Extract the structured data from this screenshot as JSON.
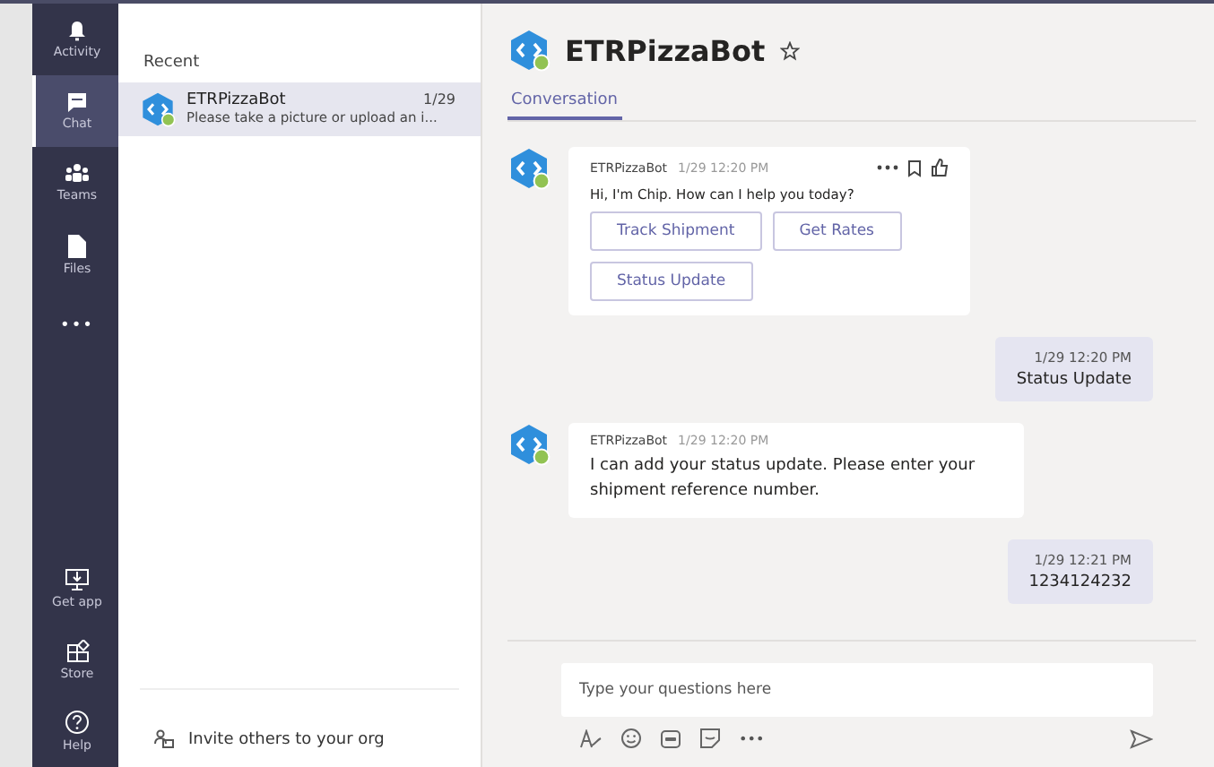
{
  "rail": {
    "top": [
      {
        "kind": "bell",
        "label": "Activity",
        "selected": false
      },
      {
        "kind": "chat",
        "label": "Chat",
        "selected": true
      },
      {
        "kind": "teams",
        "label": "Teams",
        "selected": false
      },
      {
        "kind": "file",
        "label": "Files",
        "selected": false
      },
      {
        "kind": "more",
        "label": "•••",
        "selected": false
      }
    ],
    "bottom": [
      {
        "kind": "download",
        "label": "Get app",
        "selected": false
      },
      {
        "kind": "store",
        "label": "Store",
        "selected": false
      },
      {
        "kind": "help",
        "label": "Help",
        "selected": false
      }
    ]
  },
  "chat_list": {
    "heading": "Recent",
    "items": [
      {
        "name": "ETRPizzaBot",
        "date": "1/29",
        "preview": "Please take a picture or upload an i...",
        "selected": true
      }
    ],
    "invite": "Invite others to your org"
  },
  "header": {
    "title": "ETRPizzaBot",
    "tabs": [
      {
        "label": "Conversation",
        "selected": true
      }
    ]
  },
  "messages": [
    {
      "kind": "bot",
      "sender": "ETRPizzaBot",
      "time": "1/29 12:20 PM",
      "text": "Hi, I'm Chip. How can I help you today?",
      "actions": [
        "Track Shipment",
        "Get Rates",
        "Status Update"
      ]
    },
    {
      "kind": "user",
      "time": "1/29 12:20 PM",
      "text": "Status Update"
    },
    {
      "kind": "bot",
      "sender": "ETRPizzaBot",
      "time": "1/29 12:20 PM",
      "text": "I can add your status update. Please enter your shipment reference number."
    },
    {
      "kind": "user",
      "time": "1/29 12:21 PM",
      "text": "1234124232"
    }
  ],
  "compose": {
    "placeholder": "Type your questions here",
    "more": "•••"
  }
}
